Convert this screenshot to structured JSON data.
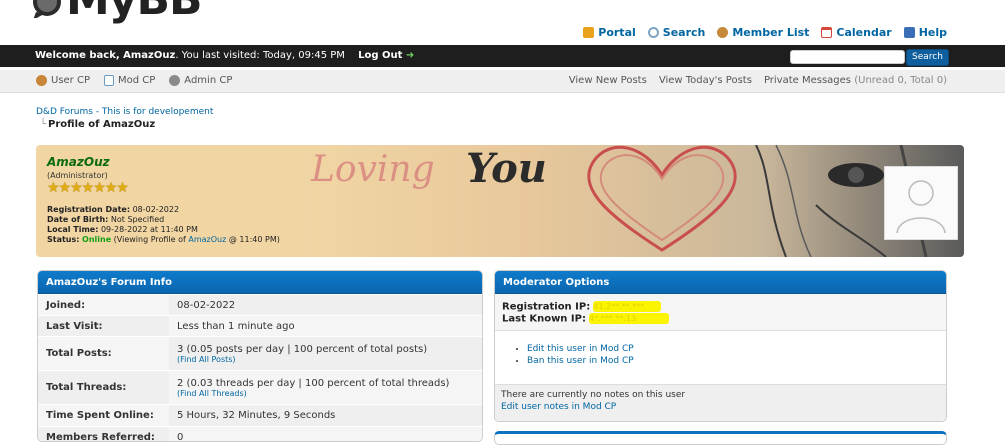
{
  "header": {
    "logo_text": "MyBB",
    "links": [
      {
        "label": "Portal",
        "icon": "portal-icon",
        "color": "#e8a21c"
      },
      {
        "label": "Search",
        "icon": "search-icon",
        "color": "#7da4c4"
      },
      {
        "label": "Member List",
        "icon": "member-list-icon",
        "color": "#c48a3a"
      },
      {
        "label": "Calendar",
        "icon": "calendar-icon",
        "color": "#d9473a"
      },
      {
        "label": "Help",
        "icon": "help-icon",
        "color": "#3a6fb5"
      }
    ]
  },
  "welcome": {
    "prefix": "Welcome back, ",
    "username": "AmazOuz",
    "suffix": ". You last visited: Today, 09:45 PM",
    "logout_label": "Log Out",
    "search_button": "Search"
  },
  "navbar": {
    "left": [
      {
        "label": "User CP",
        "icon": "user-cp-icon",
        "color": "#c9853a"
      },
      {
        "label": "Mod CP",
        "icon": "mod-cp-icon",
        "color": "#6a9bc4"
      },
      {
        "label": "Admin CP",
        "icon": "admin-cp-icon",
        "color": "#8a8a8a"
      }
    ],
    "right": {
      "new_posts": "View New Posts",
      "todays_posts": "View Today's Posts",
      "pm_label": "Private Messages",
      "pm_counts": "(Unread 0, Total 0)"
    }
  },
  "breadcrumb": {
    "root": "D&D Forums - This is for developement",
    "current": "Profile of AmazOuz"
  },
  "profile": {
    "username": "AmazOuz",
    "role": "(Administrator)",
    "stars": "★★★★★★★",
    "registration_label": "Registration Date:",
    "registration_value": "08-02-2022",
    "dob_label": "Date of Birth:",
    "dob_value": "Not Specified",
    "local_time_label": "Local Time:",
    "local_time_value": "09-28-2022 at 11:40 PM",
    "status_label": "Status:",
    "status_value": "Online",
    "status_detail_prefix": "(Viewing Profile of ",
    "status_detail_link": "AmazOuz",
    "status_detail_suffix": " @ 11:40 PM)",
    "banner_text_1": "Loving",
    "banner_text_2": "You"
  },
  "forum_info": {
    "title": "AmazOuz's Forum Info",
    "rows": [
      {
        "key": "Joined:",
        "value": "08-02-2022",
        "sub": ""
      },
      {
        "key": "Last Visit:",
        "value": "Less than 1 minute ago",
        "sub": ""
      },
      {
        "key": "Total Posts:",
        "value": "3 (0.05 posts per day | 100 percent of total posts)",
        "sub": "(Find All Posts)"
      },
      {
        "key": "Total Threads:",
        "value": "2 (0.03 threads per day | 100 percent of total threads)",
        "sub": "(Find All Threads)"
      },
      {
        "key": "Time Spent Online:",
        "value": "5 Hours, 32 Minutes, 9 Seconds",
        "sub": ""
      },
      {
        "key": "Members Referred:",
        "value": "0",
        "sub": ""
      }
    ]
  },
  "moderator": {
    "title": "Moderator Options",
    "reg_ip_label": "Registration IP:",
    "reg_ip_value": "41.2**.**.***",
    "last_ip_label": "Last Known IP:",
    "last_ip_value": "4*.***.**.13",
    "actions": [
      "Edit this user in Mod CP",
      "Ban this user in Mod CP"
    ],
    "notes_text": "There are currently no notes on this user",
    "notes_link": "Edit user notes in Mod CP"
  }
}
